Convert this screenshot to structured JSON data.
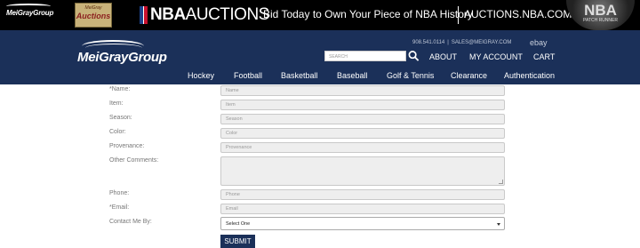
{
  "banner": {
    "left_logo": "MeiGrayGroup",
    "card_small": "MeiGray",
    "card_big": "Auctions",
    "nba_bold": "NBA",
    "nba_rest": "AUCTIONS",
    "tagline": "Bid Today to Own Your Piece of NBA History",
    "url": "AUCTIONS.NBA.COM",
    "jersey_text": "NBA",
    "jersey_sub": "PATCH RUNNER",
    "background": "#000000"
  },
  "header": {
    "logo": "MeiGrayGroup",
    "phone": "908.541.0114",
    "separator": "|",
    "email": "SALES@MEIGRAY.COM",
    "ebay": "ebay",
    "search_placeholder": "SEARCH",
    "links": {
      "about": "ABOUT",
      "account": "MY ACCOUNT",
      "cart": "CART"
    },
    "nav": [
      "Hockey",
      "Football",
      "Basketball",
      "Baseball",
      "Golf & Tennis",
      "Clearance",
      "Authentication"
    ],
    "background": "#1b3059"
  },
  "form": {
    "fields": [
      {
        "label": "*Name:",
        "placeholder": "Name"
      },
      {
        "label": "Item:",
        "placeholder": "Item"
      },
      {
        "label": "Season:",
        "placeholder": "Season"
      },
      {
        "label": "Color:",
        "placeholder": "Color"
      },
      {
        "label": "Provenance:",
        "placeholder": "Provenance"
      },
      {
        "label": "Other Comments:",
        "placeholder": ""
      },
      {
        "label": "Phone:",
        "placeholder": "Phone"
      },
      {
        "label": "*Email:",
        "placeholder": "Email"
      }
    ],
    "contact_label": "Contact Me By:",
    "contact_selected": "Select One",
    "submit_label": "SUBMIT"
  }
}
